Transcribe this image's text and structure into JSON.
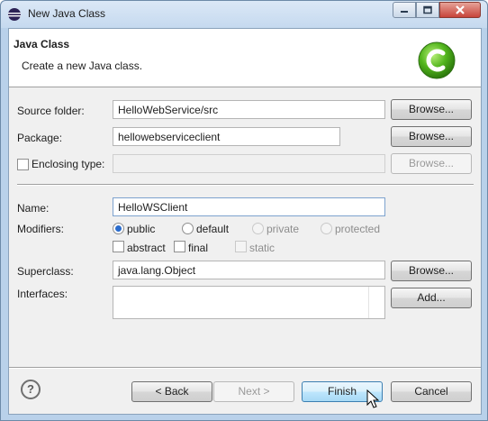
{
  "window": {
    "title": "New Java Class"
  },
  "banner": {
    "title": "Java Class",
    "description": "Create a new Java class.",
    "icon": "java-class-wizard-icon"
  },
  "form": {
    "source_folder": {
      "label": "Source folder:",
      "value": "HelloWebService/src",
      "browse": "Browse..."
    },
    "package": {
      "label": "Package:",
      "value": "hellowebserviceclient",
      "browse": "Browse..."
    },
    "enclosing_type": {
      "label": "Enclosing type:",
      "checked": false,
      "value": "",
      "browse": "Browse..."
    },
    "name": {
      "label": "Name:",
      "value": "HelloWSClient"
    },
    "modifiers": {
      "label": "Modifiers:",
      "access": [
        "public",
        "default",
        "private",
        "protected"
      ],
      "selected": "public",
      "extra": [
        "abstract",
        "final",
        "static"
      ]
    },
    "superclass": {
      "label": "Superclass:",
      "value": "java.lang.Object",
      "browse": "Browse..."
    },
    "interfaces": {
      "label": "Interfaces:",
      "add": "Add..."
    }
  },
  "footer": {
    "help": "?",
    "back": "< Back",
    "next": "Next >",
    "finish": "Finish",
    "cancel": "Cancel"
  },
  "colors": {
    "accent": "#3c7fb1",
    "title_bar": "#c5d9ef",
    "icon_green": "#52b51d"
  }
}
